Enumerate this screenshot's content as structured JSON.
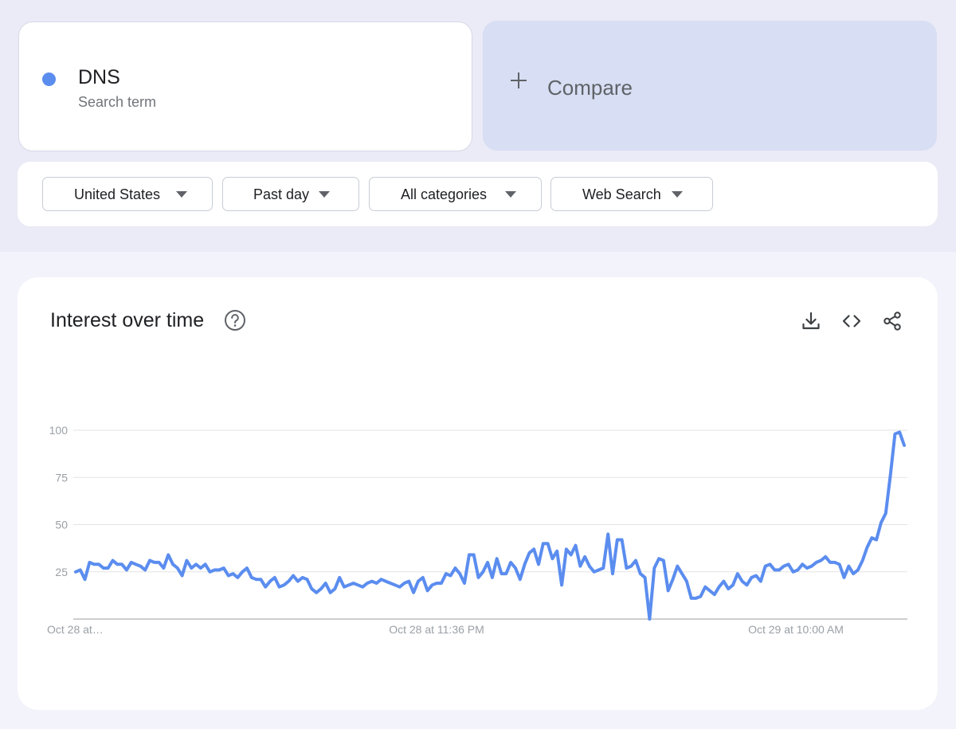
{
  "search_term": {
    "name": "DNS",
    "subtitle": "Search term",
    "color": "#5b8def"
  },
  "compare": {
    "label": "Compare",
    "icon": "plus-icon"
  },
  "filters": {
    "region": "United States",
    "time": "Past day",
    "category": "All categories",
    "search_type": "Web Search"
  },
  "chart": {
    "title": "Interest over time",
    "icons": [
      "help-icon",
      "download-icon",
      "embed-code-icon",
      "share-icon"
    ]
  },
  "chart_data": {
    "type": "line",
    "title": "Interest over time",
    "xlabel": "",
    "ylabel": "",
    "ylim": [
      0,
      100
    ],
    "yticks": [
      25,
      50,
      75,
      100
    ],
    "grid": true,
    "x_tick_labels": [
      "Oct 28 at…",
      "Oct 28 at 11:36 PM",
      "Oct 29 at 10:00 AM"
    ],
    "series": [
      {
        "name": "DNS",
        "color": "#5b8def",
        "values": [
          25,
          26,
          21,
          30,
          29,
          29,
          27,
          27,
          31,
          29,
          29,
          26,
          30,
          29,
          28,
          26,
          31,
          30,
          30,
          27,
          34,
          29,
          27,
          23,
          31,
          27,
          29,
          27,
          29,
          25,
          26,
          26,
          27,
          23,
          24,
          22,
          25,
          27,
          22,
          21,
          21,
          17,
          20,
          22,
          17,
          18,
          20,
          23,
          20,
          22,
          21,
          16,
          14,
          16,
          19,
          14,
          16,
          22,
          17,
          18,
          19,
          18,
          17,
          19,
          20,
          19,
          21,
          20,
          19,
          18,
          17,
          19,
          20,
          14,
          20,
          22,
          15,
          18,
          19,
          19,
          24,
          23,
          27,
          24,
          19,
          34,
          34,
          22,
          25,
          30,
          22,
          32,
          24,
          24,
          30,
          27,
          21,
          29,
          35,
          37,
          29,
          40,
          40,
          32,
          36,
          18,
          37,
          34,
          39,
          28,
          33,
          28,
          25,
          26,
          27,
          45,
          24,
          42,
          42,
          27,
          28,
          31,
          24,
          22,
          0,
          27,
          32,
          31,
          15,
          21,
          28,
          24,
          20,
          11,
          11,
          12,
          17,
          15,
          13,
          17,
          20,
          16,
          18,
          24,
          20,
          18,
          22,
          23,
          20,
          28,
          29,
          26,
          26,
          28,
          29,
          25,
          26,
          29,
          27,
          28,
          30,
          31,
          33,
          30,
          30,
          29,
          22,
          28,
          24,
          26,
          31,
          38,
          43,
          42,
          51,
          56,
          76,
          98,
          99,
          92
        ]
      }
    ]
  }
}
